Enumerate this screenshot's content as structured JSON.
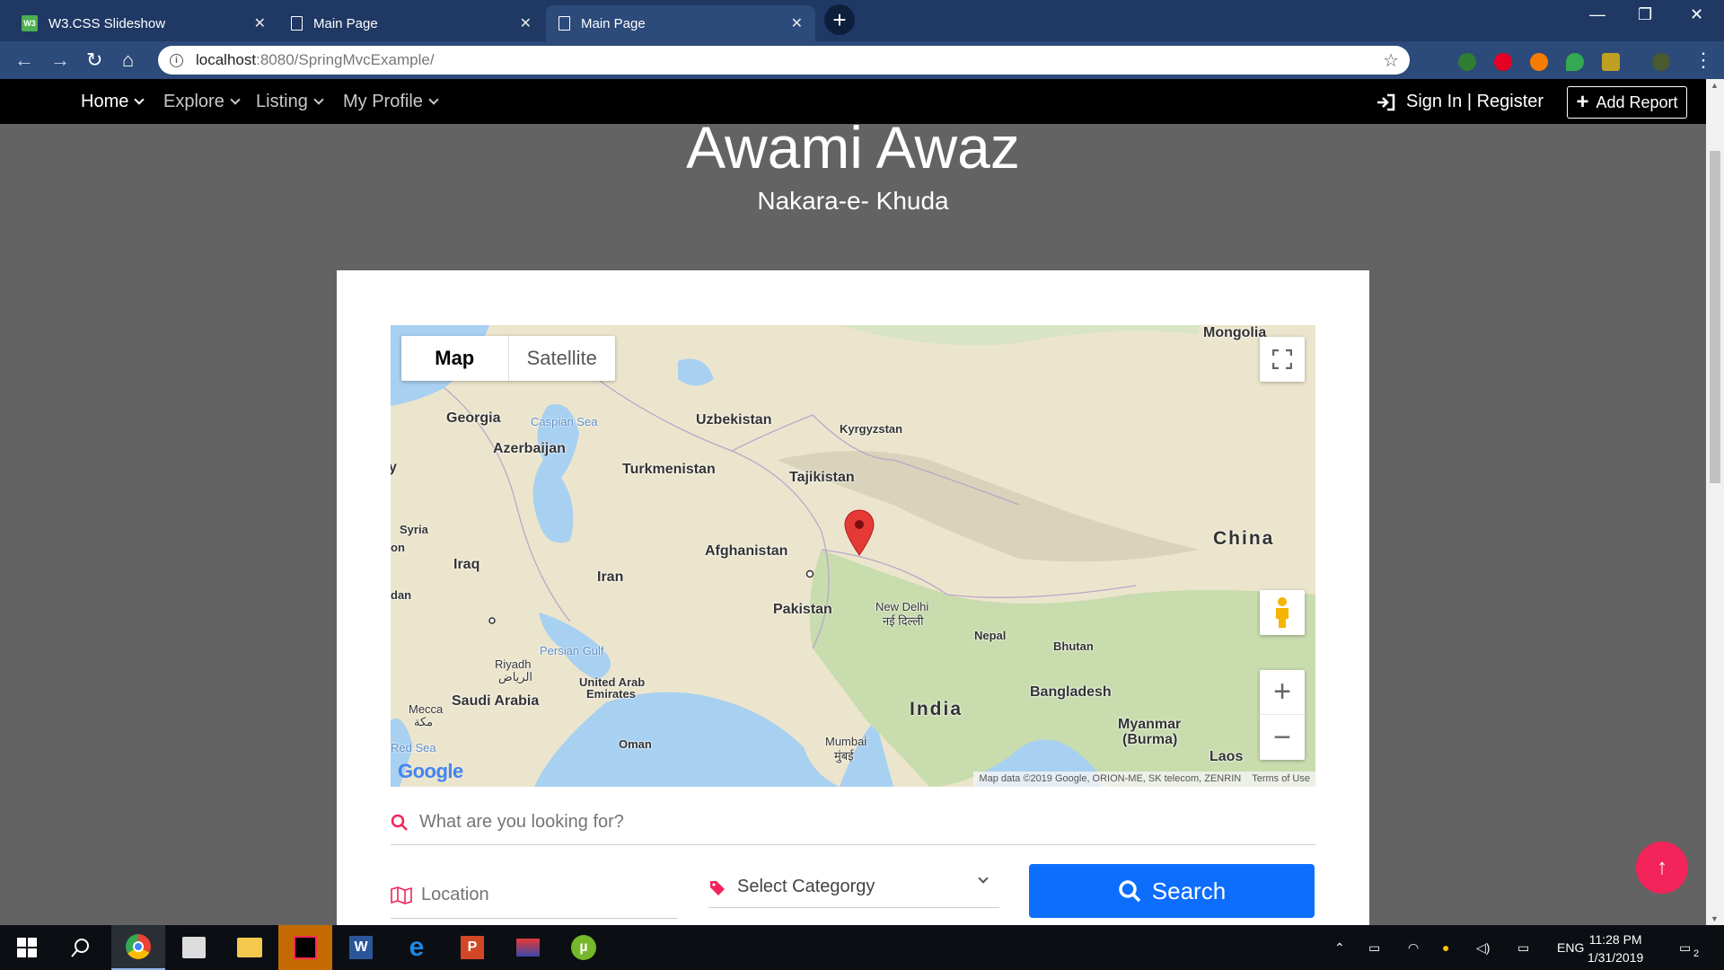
{
  "browser": {
    "tabs": [
      {
        "title": "W3.CSS Slideshow",
        "icon": "w3css-icon"
      },
      {
        "title": "Main Page",
        "icon": "page-icon"
      },
      {
        "title": "Main Page",
        "icon": "page-icon"
      }
    ],
    "url_host": "localhost",
    "url_rest": ":8080/SpringMvcExample/"
  },
  "nav": {
    "home": "Home",
    "explore": "Explore",
    "listing": "Listing",
    "profile": "My Profile",
    "signin": "Sign In | Register",
    "add_report": "Add Report"
  },
  "hero": {
    "title": "Awami Awaz",
    "subtitle": "Nakara-e- Khuda"
  },
  "map": {
    "type_map": "Map",
    "type_satellite": "Satellite",
    "labels": {
      "mongolia": "Mongolia",
      "georgia": "Georgia",
      "caspian": "Caspian Sea",
      "uzbekistan": "Uzbekistan",
      "kyrgyzstan": "Kyrgyzstan",
      "azerbaijan": "Azerbaijan",
      "turkmenistan": "Turkmenistan",
      "tajikistan": "Tajikistan",
      "syria": "Syria",
      "iraq": "Iraq",
      "iran": "Iran",
      "afghanistan": "Afghanistan",
      "china": "China",
      "pakistan": "Pakistan",
      "new_delhi": "New Delhi",
      "new_delhi_hi": "नई दिल्ली",
      "nepal": "Nepal",
      "bhutan": "Bhutan",
      "persian_gulf": "Persian Gulf",
      "riyadh": "Riyadh",
      "riyadh_ar": "الرياض",
      "uae1": "United Arab",
      "uae2": "Emirates",
      "saudi": "Saudi Arabia",
      "bangladesh": "Bangladesh",
      "mecca": "Mecca",
      "mecca_ar": "مكة",
      "india": "India",
      "myanmar1": "Myanmar",
      "myanmar2": "(Burma)",
      "mumbai": "Mumbai",
      "mumbai_hi": "मुंबई",
      "oman": "Oman",
      "laos": "Laos",
      "red_sea": "Red Sea",
      "edge_y": "y",
      "edge_on": "on",
      "edge_dan": "dan"
    },
    "google": "Google",
    "attribution": "Map data ©2019 Google, ORION-ME, SK telecom, ZENRIN",
    "terms": "Terms of Use"
  },
  "search": {
    "placeholder": "What are you looking for?",
    "location_placeholder": "Location",
    "category": "Select Categorgy",
    "button": "Search"
  },
  "totop": "↑",
  "taskbar": {
    "lang": "ENG",
    "time": "11:28 PM",
    "date": "1/31/2019",
    "notif_count": "2"
  },
  "colors": {
    "accent": "#0d6efd",
    "totop": "#f2245a",
    "chrome": "#1f3864",
    "pin": "#e53935"
  }
}
